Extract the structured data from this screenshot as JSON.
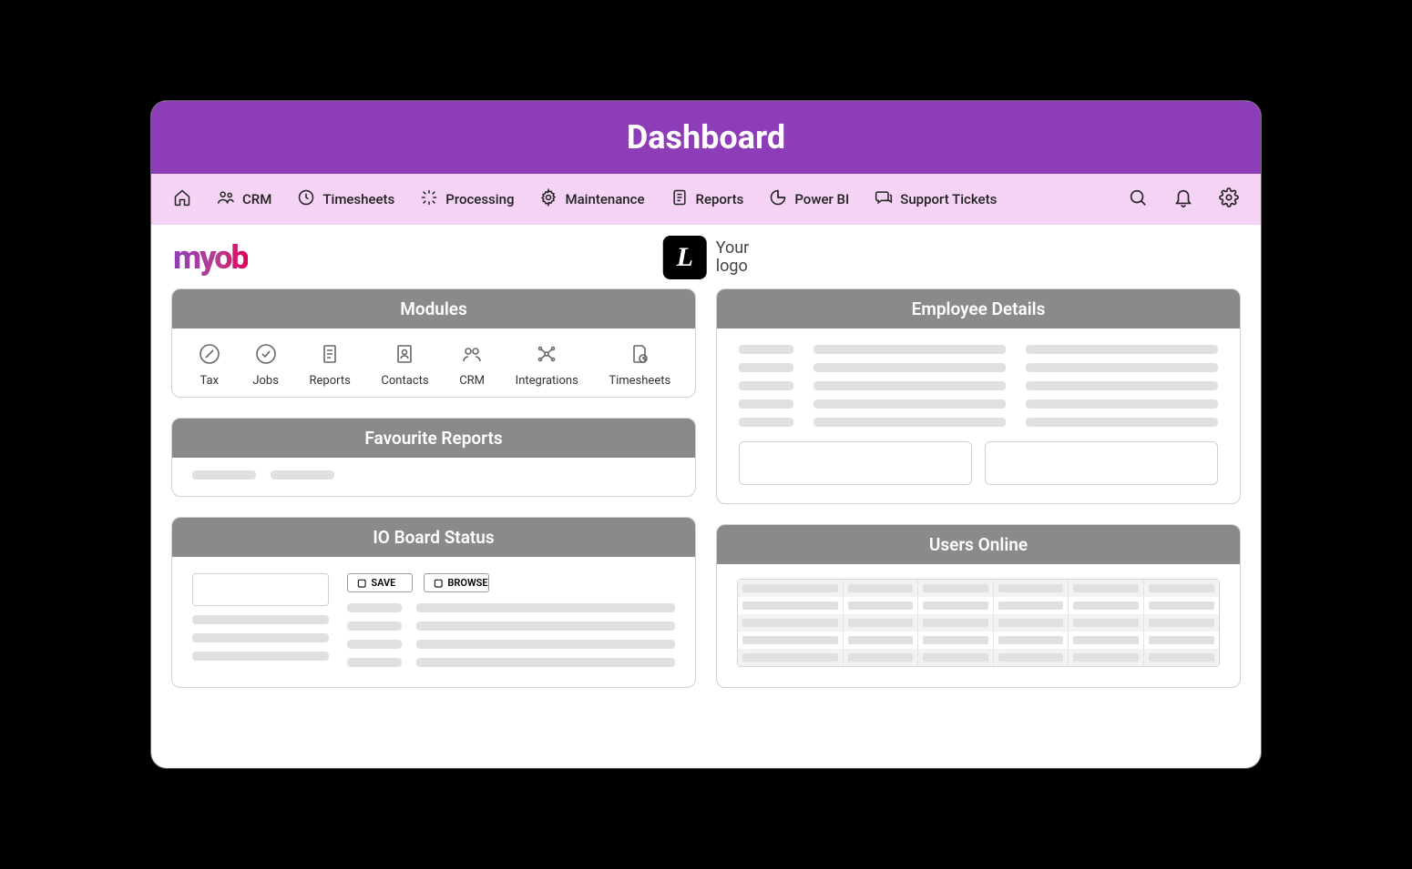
{
  "title": "Dashboard",
  "nav": {
    "crm": "CRM",
    "timesheets": "Timesheets",
    "processing": "Processing",
    "maintenance": "Maintenance",
    "reports": "Reports",
    "powerbi": "Power BI",
    "tickets": "Support Tickets"
  },
  "logos": {
    "myob": "myob",
    "your_logo_line1": "Your",
    "your_logo_line2": "logo",
    "your_logo_letter": "L"
  },
  "cards": {
    "modules": "Modules",
    "fav_reports": "Favourite Reports",
    "io_board": "IO Board Status",
    "employee": "Employee Details",
    "users_online": "Users Online"
  },
  "modules": {
    "tax": "Tax",
    "jobs": "Jobs",
    "reports": "Reports",
    "contacts": "Contacts",
    "crm": "CRM",
    "integrations": "Integrations",
    "timesheets": "Timesheets"
  },
  "io": {
    "save": "SAVE",
    "browse": "BROWSE"
  }
}
